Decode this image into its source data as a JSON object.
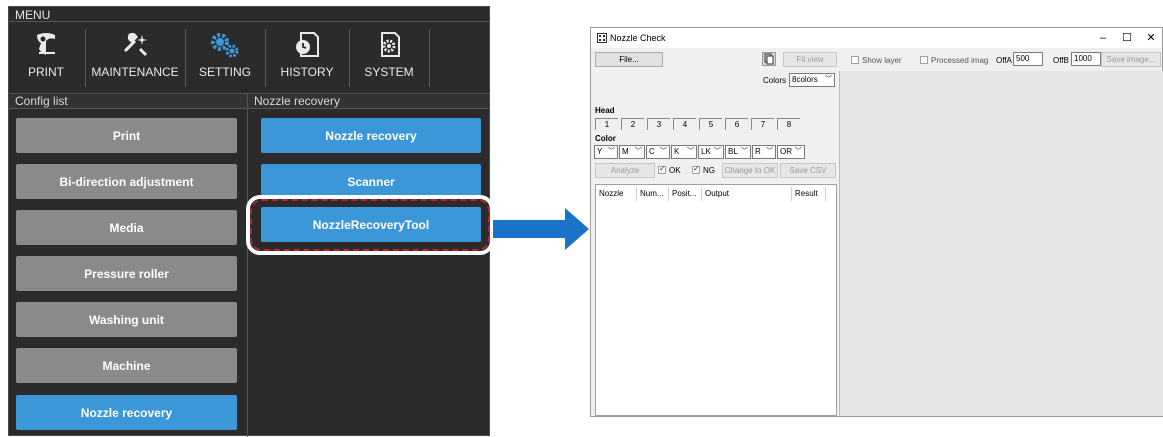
{
  "menu": {
    "title": "MENU",
    "nav": [
      {
        "label": "PRINT",
        "icon": "print-icon"
      },
      {
        "label": "MAINTENANCE",
        "icon": "maintenance-icon"
      },
      {
        "label": "SETTING",
        "icon": "gear-icon"
      },
      {
        "label": "HISTORY",
        "icon": "history-icon"
      },
      {
        "label": "SYSTEM",
        "icon": "system-icon"
      }
    ],
    "active_nav": "SETTING",
    "config_list_title": "Config list",
    "config_items": [
      "Print",
      "Bi-direction adjustment",
      "Media",
      "Pressure roller",
      "Washing unit",
      "Machine",
      "Nozzle recovery"
    ],
    "active_config": "Nozzle recovery",
    "nozzle_recovery_title": "Nozzle recovery",
    "nozzle_recovery_items": [
      "Nozzle recovery",
      "Scanner",
      "NozzleRecoveryTool"
    ],
    "highlighted_item": "NozzleRecoveryTool",
    "colors": {
      "panel": "#2b2b2b",
      "button_gray": "#8a8a8a",
      "button_blue": "#3c97d9",
      "highlight": "#c0202a",
      "arrow": "#1a73c8"
    }
  },
  "window": {
    "title": "Nozzle Check",
    "controls": {
      "minimize": "–",
      "maximize": "☐",
      "close": "✕"
    },
    "file_button": "File...",
    "fit_view_button": "Fit view",
    "show_layer_label": "Show layer",
    "processed_image_label": "Processed imag",
    "offa_label": "OffA",
    "offa_value": "500",
    "offb_label": "OffB",
    "offb_value": "1000",
    "save_image_button": "Save image...",
    "colors_label": "Colors",
    "colors_value": "8colors",
    "head_label": "Head",
    "head_tabs": [
      "1",
      "2",
      "3",
      "4",
      "5",
      "6",
      "7",
      "8"
    ],
    "color_label": "Color",
    "color_selects": [
      "Y",
      "M",
      "C",
      "K",
      "LK",
      "BL",
      "R",
      "OR"
    ],
    "analyze_button": "Analyze",
    "ok_label": "OK",
    "ng_label": "NG",
    "change_to_ok_button": "Change to OK",
    "save_csv_button": "Save CSV",
    "columns": [
      "Nozzle",
      "Num...",
      "Posit...",
      "Output",
      "Result"
    ]
  }
}
